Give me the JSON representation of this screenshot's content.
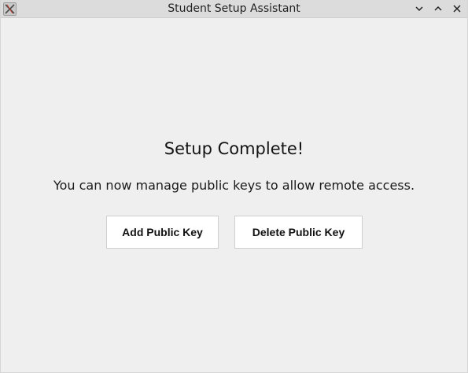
{
  "window": {
    "title": "Student Setup Assistant",
    "icon": "app-icon",
    "controls": [
      "minimize-icon",
      "maximize-icon",
      "close-icon"
    ]
  },
  "main": {
    "heading": "Setup Complete!",
    "message": "You can now manage public keys to allow remote access.",
    "add_button_label": "Add Public Key",
    "delete_button_label": "Delete Public Key"
  },
  "colors": {
    "background": "#efefef",
    "titlebar": "#dcdcdc",
    "button_background": "#ffffff",
    "button_border": "#cfcfcf"
  }
}
